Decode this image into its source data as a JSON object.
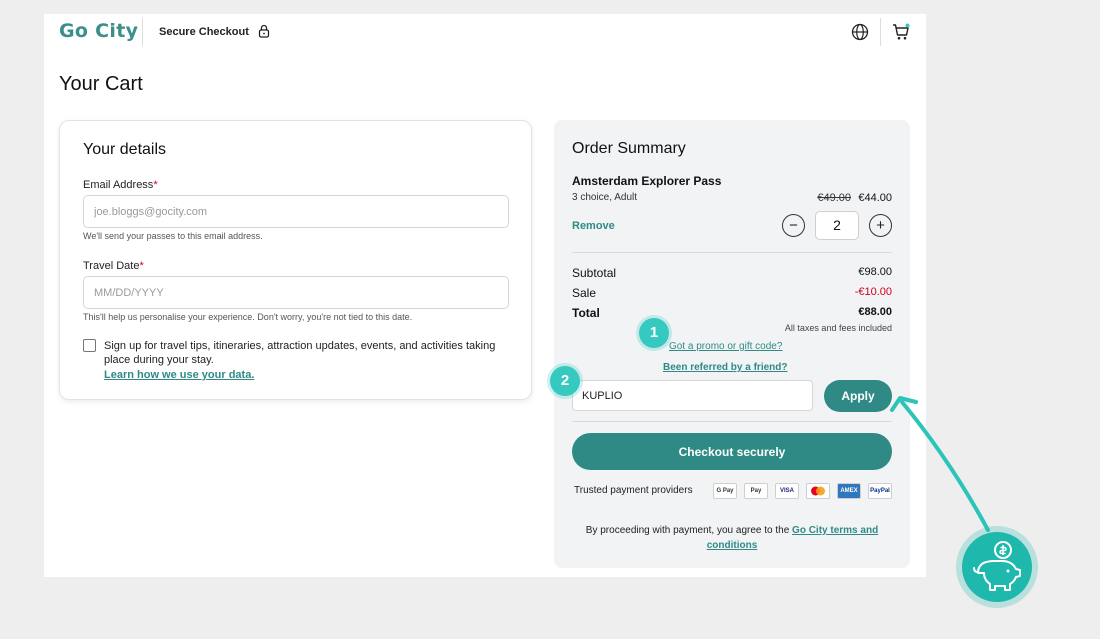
{
  "header": {
    "logo": "Go City",
    "secure_checkout": "Secure Checkout"
  },
  "page_title": "Your Cart",
  "details": {
    "heading": "Your details",
    "email_label": "Email Address",
    "required_mark": "*",
    "email_placeholder": "joe.bloggs@gocity.com",
    "email_hint": "We'll send your passes to this email address.",
    "travel_label": "Travel Date",
    "travel_placeholder": "MM/DD/YYYY",
    "travel_hint": "This'll help us personalise your experience. Don't worry, you're not tied to this date.",
    "signup_text": "Sign up for travel tips, itineraries, attraction updates, events, and activities taking place during your stay.",
    "learn_link": "Learn how we use your data."
  },
  "summary": {
    "heading": "Order Summary",
    "product_name": "Amsterdam Explorer Pass",
    "product_variant": "3 choice, Adult",
    "price_old": "€49.00",
    "price_new": "€44.00",
    "remove": "Remove",
    "quantity": "2",
    "minus": "−",
    "plus": "+",
    "subtotal_label": "Subtotal",
    "subtotal_value": "€98.00",
    "sale_label": "Sale",
    "sale_value": "-€10.00",
    "total_label": "Total",
    "total_value": "€88.00",
    "taxes_note": "All taxes and fees included",
    "promo_link": "Got a promo or gift code?",
    "referred_link": "Been referred by a friend?",
    "promo_value": "KUPLIO",
    "apply": "Apply",
    "checkout": "Checkout securely",
    "trusted_label": "Trusted payment providers",
    "payment_icons": [
      "G Pay",
      "Pay",
      "VISA",
      "MC",
      "AMEX",
      "PayPal"
    ],
    "terms_prefix": "By proceeding with payment, you agree to the ",
    "terms_link": "Go City terms and conditions"
  },
  "annotations": {
    "badge_1": "1",
    "badge_2": "2"
  },
  "colors": {
    "brand": "#2f8a86",
    "accent": "#36c9bf",
    "sale": "#d0021b"
  }
}
